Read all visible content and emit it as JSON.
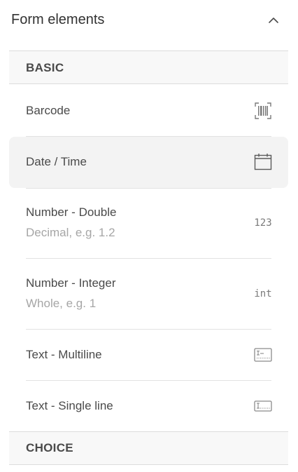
{
  "panel": {
    "title": "Form elements"
  },
  "sections": {
    "basic_label": "BASIC",
    "choice_label": "CHOICE"
  },
  "items": [
    {
      "label": "Barcode",
      "icon": "barcode-icon"
    },
    {
      "label": "Date / Time",
      "icon": "calendar-icon"
    },
    {
      "label": "Number - Double",
      "description": "Decimal, e.g. 1.2",
      "icon": "number-icon",
      "icon_text": "123"
    },
    {
      "label": "Number - Integer",
      "description": "Whole, e.g. 1",
      "icon": "integer-icon",
      "icon_text": "int"
    },
    {
      "label": "Text - Multiline",
      "icon": "text-multiline-icon"
    },
    {
      "label": "Text - Single line",
      "icon": "text-single-line-icon"
    }
  ],
  "colors": {
    "text": "#4a4a4a",
    "muted": "#a6a6a6",
    "icon": "#7a7a7a",
    "section_bg": "#f8f8f8",
    "hover_bg": "#f3f3f3",
    "divider": "#e2e2e2"
  }
}
